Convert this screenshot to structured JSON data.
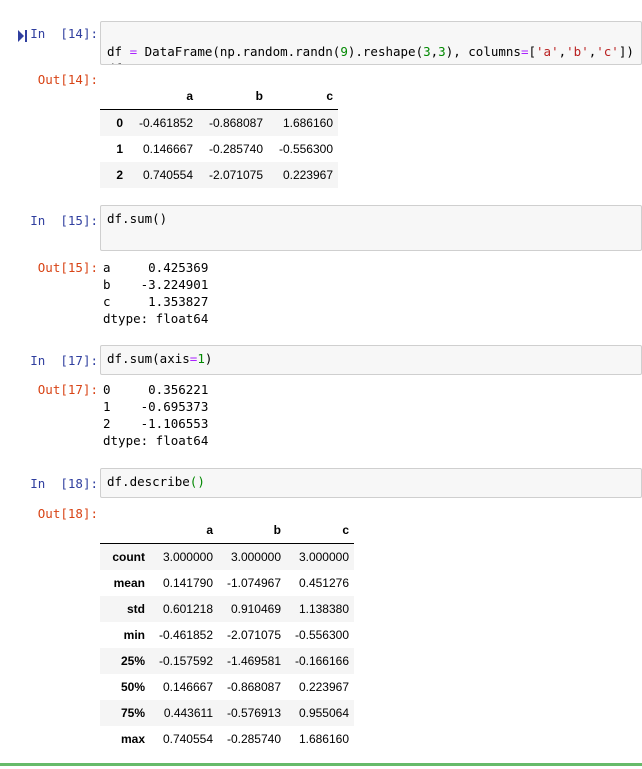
{
  "cells": [
    {
      "in_prompt": "In  [14]:",
      "out_prompt": "Out[14]:",
      "code_line1": {
        "p1": "df ",
        "eq": "=",
        "p2": " DataFrame(np.random.randn(",
        "n1": "9",
        "p3": ").reshape(",
        "n2": "3",
        "p4": ",",
        "n3": "3",
        "p5": "), columns",
        "eq2": "=",
        "p6": "[",
        "s1": "'a'",
        "c1": ",",
        "s2": "'b'",
        "c2": ",",
        "s3": "'c'",
        "p7": "])"
      },
      "code_line2": "df",
      "table": {
        "columns": [
          "",
          "a",
          "b",
          "c"
        ],
        "rows": [
          [
            "0",
            "-0.461852",
            "-0.868087",
            "1.686160"
          ],
          [
            "1",
            "0.146667",
            "-0.285740",
            "-0.556300"
          ],
          [
            "2",
            "0.740554",
            "-2.071075",
            "0.223967"
          ]
        ]
      }
    },
    {
      "in_prompt": "In  [15]:",
      "out_prompt": "Out[15]:",
      "code": "df.sum()",
      "output": "a     0.425369\nb    -3.224901\nc     1.353827\ndtype: float64"
    },
    {
      "in_prompt": "In  [17]:",
      "out_prompt": "Out[17]:",
      "code_pre": "df.sum(axis",
      "code_eq": "=",
      "code_num": "1",
      "code_post": ")",
      "output": "0     0.356221\n1    -0.695373\n2    -1.106553\ndtype: float64"
    },
    {
      "in_prompt": "In  [18]:",
      "out_prompt": "Out[18]:",
      "code_pre": "df.describe",
      "code_paren": "()",
      "table": {
        "columns": [
          "",
          "a",
          "b",
          "c"
        ],
        "rows": [
          [
            "count",
            "3.000000",
            "3.000000",
            "3.000000"
          ],
          [
            "mean",
            "0.141790",
            "-1.074967",
            "0.451276"
          ],
          [
            "std",
            "0.601218",
            "0.910469",
            "1.138380"
          ],
          [
            "min",
            "-0.461852",
            "-2.071075",
            "-0.556300"
          ],
          [
            "25%",
            "-0.157592",
            "-1.469581",
            "-0.166166"
          ],
          [
            "50%",
            "0.146667",
            "-0.868087",
            "0.223967"
          ],
          [
            "75%",
            "0.443611",
            "-0.576913",
            "0.955064"
          ],
          [
            "max",
            "0.740554",
            "-0.285740",
            "1.686160"
          ]
        ]
      }
    }
  ]
}
